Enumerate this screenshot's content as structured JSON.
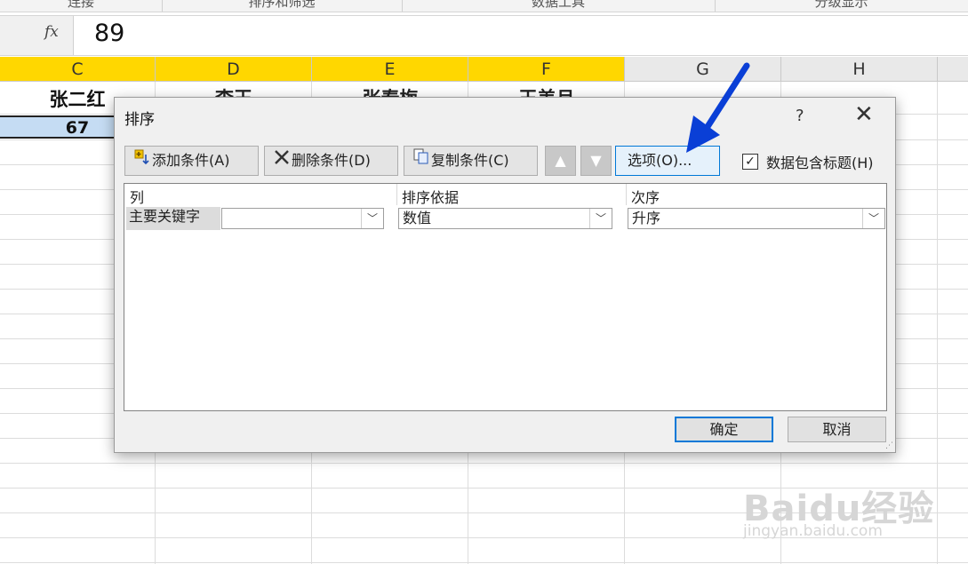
{
  "ribbon": {
    "groups": [
      "连接",
      "排序和筛选",
      "数据工具",
      "分级显示"
    ]
  },
  "formula_bar": {
    "fx_label": "fx",
    "value": "89"
  },
  "columns": [
    "C",
    "D",
    "E",
    "F",
    "G",
    "H"
  ],
  "sheet": {
    "row1": [
      "张二红",
      "李王",
      "张春梅",
      "王美月"
    ],
    "row2_value": "67"
  },
  "dialog": {
    "title": "排序",
    "help": "?",
    "close": "✕",
    "toolbar": {
      "add": "添加条件(A)",
      "delete": "删除条件(D)",
      "copy": "复制条件(C)",
      "up": "▲",
      "down": "▼",
      "options": "选项(O)...",
      "header_checkbox": "数据包含标题(H)",
      "header_checked": true
    },
    "list": {
      "headers": [
        "列",
        "排序依据",
        "次序"
      ],
      "rows": [
        {
          "label": "主要关键字",
          "column": "",
          "sort_on": "数值",
          "order": "升序"
        }
      ]
    },
    "ok": "确定",
    "cancel": "取消"
  },
  "annotation": {
    "arrow_color": "#0a3fd6"
  },
  "watermark": {
    "logo": "Baidu经验",
    "url": "jingyan.baidu.com"
  }
}
